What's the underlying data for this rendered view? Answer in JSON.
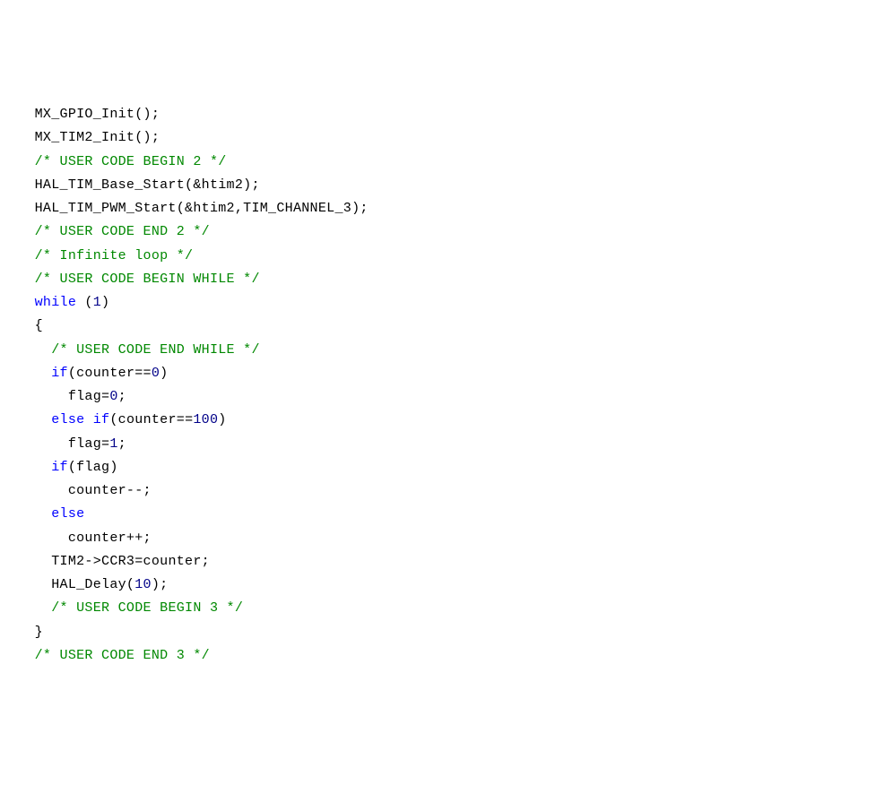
{
  "code": {
    "lines": [
      {
        "indent": "  ",
        "tokens": [
          {
            "t": "plain",
            "v": "MX_GPIO_Init();"
          }
        ]
      },
      {
        "indent": "  ",
        "tokens": [
          {
            "t": "plain",
            "v": "MX_TIM2_Init();"
          }
        ]
      },
      {
        "indent": "  ",
        "tokens": [
          {
            "t": "comment",
            "v": "/* USER CODE BEGIN 2 */"
          }
        ]
      },
      {
        "indent": "  ",
        "tokens": [
          {
            "t": "plain",
            "v": "HAL_TIM_Base_Start(&htim2);"
          }
        ]
      },
      {
        "indent": "  ",
        "tokens": [
          {
            "t": "plain",
            "v": "HAL_TIM_PWM_Start(&htim2,TIM_CHANNEL_3);"
          }
        ]
      },
      {
        "indent": "  ",
        "tokens": [
          {
            "t": "comment",
            "v": "/* USER CODE END 2 */"
          }
        ]
      },
      {
        "indent": "",
        "tokens": []
      },
      {
        "indent": "  ",
        "tokens": [
          {
            "t": "comment",
            "v": "/* Infinite loop */"
          }
        ]
      },
      {
        "indent": "  ",
        "tokens": [
          {
            "t": "comment",
            "v": "/* USER CODE BEGIN WHILE */"
          }
        ]
      },
      {
        "indent": "  ",
        "tokens": [
          {
            "t": "keyword",
            "v": "while"
          },
          {
            "t": "plain",
            "v": " ("
          },
          {
            "t": "number",
            "v": "1"
          },
          {
            "t": "plain",
            "v": ")"
          }
        ]
      },
      {
        "indent": "  ",
        "tokens": [
          {
            "t": "plain",
            "v": "{"
          }
        ]
      },
      {
        "indent": "    ",
        "tokens": [
          {
            "t": "comment",
            "v": "/* USER CODE END WHILE */"
          }
        ]
      },
      {
        "indent": "    ",
        "tokens": [
          {
            "t": "keyword",
            "v": "if"
          },
          {
            "t": "plain",
            "v": "(counter=="
          },
          {
            "t": "number",
            "v": "0"
          },
          {
            "t": "plain",
            "v": ")"
          }
        ]
      },
      {
        "indent": "      ",
        "tokens": [
          {
            "t": "plain",
            "v": "flag="
          },
          {
            "t": "number",
            "v": "0"
          },
          {
            "t": "plain",
            "v": ";"
          }
        ]
      },
      {
        "indent": "    ",
        "tokens": [
          {
            "t": "keyword",
            "v": "else"
          },
          {
            "t": "plain",
            "v": " "
          },
          {
            "t": "keyword",
            "v": "if"
          },
          {
            "t": "plain",
            "v": "(counter=="
          },
          {
            "t": "number",
            "v": "100"
          },
          {
            "t": "plain",
            "v": ")"
          }
        ]
      },
      {
        "indent": "      ",
        "tokens": [
          {
            "t": "plain",
            "v": "flag="
          },
          {
            "t": "number",
            "v": "1"
          },
          {
            "t": "plain",
            "v": ";"
          }
        ]
      },
      {
        "indent": "    ",
        "tokens": [
          {
            "t": "keyword",
            "v": "if"
          },
          {
            "t": "plain",
            "v": "(flag)"
          }
        ]
      },
      {
        "indent": "      ",
        "tokens": [
          {
            "t": "plain",
            "v": "counter--;"
          }
        ]
      },
      {
        "indent": "    ",
        "tokens": [
          {
            "t": "keyword",
            "v": "else"
          }
        ]
      },
      {
        "indent": "      ",
        "tokens": [
          {
            "t": "plain",
            "v": "counter++;"
          }
        ]
      },
      {
        "indent": "    ",
        "tokens": [
          {
            "t": "plain",
            "v": "TIM2->CCR3=counter;"
          }
        ]
      },
      {
        "indent": "    ",
        "tokens": [
          {
            "t": "plain",
            "v": "HAL_Delay("
          },
          {
            "t": "number",
            "v": "10"
          },
          {
            "t": "plain",
            "v": ");"
          }
        ]
      },
      {
        "indent": "    ",
        "tokens": [
          {
            "t": "comment",
            "v": "/* USER CODE BEGIN 3 */"
          }
        ]
      },
      {
        "indent": "  ",
        "tokens": [
          {
            "t": "plain",
            "v": "}"
          }
        ]
      },
      {
        "indent": "  ",
        "tokens": [
          {
            "t": "comment",
            "v": "/* USER CODE END 3 */"
          }
        ]
      }
    ]
  }
}
